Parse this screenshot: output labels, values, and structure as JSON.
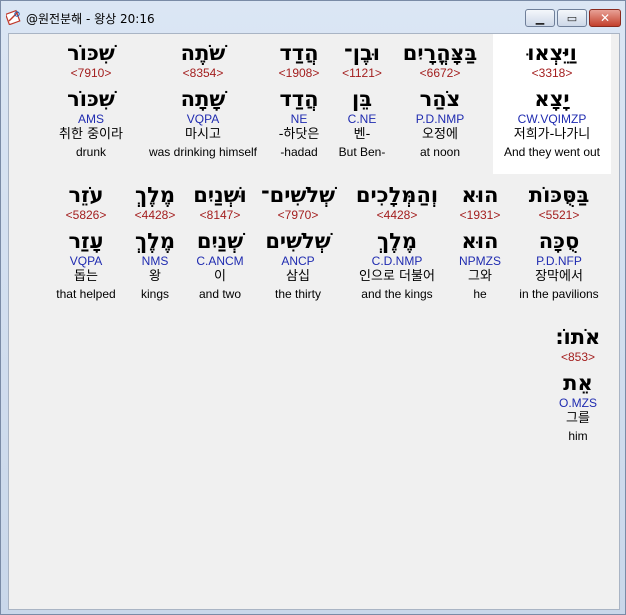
{
  "window": {
    "title": "@원전분해 - 왕상 20:16",
    "app_icon": "compass-book-icon",
    "controls": {
      "minimize": "minimize-icon",
      "maximize": "maximize-icon",
      "close": "close-icon"
    }
  },
  "words": [
    {
      "surface": "וַיֵּצְאוּ",
      "strong": "<3318>",
      "lemma": "יָצָא",
      "parse": "CW.VQIMZP",
      "korean": "저희가-나가니",
      "english": "And they went out",
      "selected": true
    },
    {
      "surface": "בַּצָּהֳרָיִם",
      "strong": "<6672>",
      "lemma": "צֹהַר",
      "parse": "P.D.NMP",
      "korean": "오정에",
      "english": "at noon"
    },
    {
      "surface": "וּבֶן־",
      "strong": "<1121>",
      "lemma": "בֵּן",
      "parse": "C.NE",
      "korean": "벤-",
      "english": "But Ben-"
    },
    {
      "surface": "הֲדַד",
      "strong": "<1908>",
      "lemma": "הֲדַד",
      "parse": "NE",
      "korean": "-하닷은",
      "english": "-hadad"
    },
    {
      "surface": "שֹׁתֶה",
      "strong": "<8354>",
      "lemma": "שָׁתָה",
      "parse": "VQPA",
      "korean": "마시고",
      "english": "was drinking himself"
    },
    {
      "surface": "שִׁכּוֹר",
      "strong": "<7910>",
      "lemma": "שִׁכּוֹר",
      "parse": "AMS",
      "korean": "취한 중이라",
      "english": "drunk"
    },
    {
      "surface": "בַּסֻּכּוֹת",
      "strong": "<5521>",
      "lemma": "סֻכָּה",
      "parse": "P.D.NFP",
      "korean": "장막에서",
      "english": "in the pavilions"
    },
    {
      "surface": "הוּא",
      "strong": "<1931>",
      "lemma": "הוּא",
      "parse": "NPMZS",
      "korean": "그와",
      "english": "he"
    },
    {
      "surface": "וְהַמְּלָכִים",
      "strong": "<4428>",
      "lemma": "מֶלֶךְ",
      "parse": "C.D.NMP",
      "korean": "인으로 더불어",
      "english": "and the kings"
    },
    {
      "surface": "שְׁלֹשִׁים־",
      "strong": "<7970>",
      "lemma": "שְׁלֹשִׁים",
      "parse": "ANCP",
      "korean": "삼십",
      "english": "the thirty"
    },
    {
      "surface": "וּשְׁנַיִם",
      "strong": "<8147>",
      "lemma": "שְׁנַיִם",
      "parse": "C.ANCM",
      "korean": "이",
      "english": "and two"
    },
    {
      "surface": "מֶלֶךְ",
      "strong": "<4428>",
      "lemma": "מֶלֶךְ",
      "parse": "NMS",
      "korean": "왕",
      "english": "kings"
    },
    {
      "surface": "עֹזֵר",
      "strong": "<5826>",
      "lemma": "עָזַר",
      "parse": "VQPA",
      "korean": "돕는",
      "english": "that helped"
    },
    {
      "surface": "אֹתוֹ׃",
      "strong": "<853>",
      "lemma": "אֵת",
      "parse": "O.MZS",
      "korean": "그를",
      "english": "him"
    }
  ]
}
